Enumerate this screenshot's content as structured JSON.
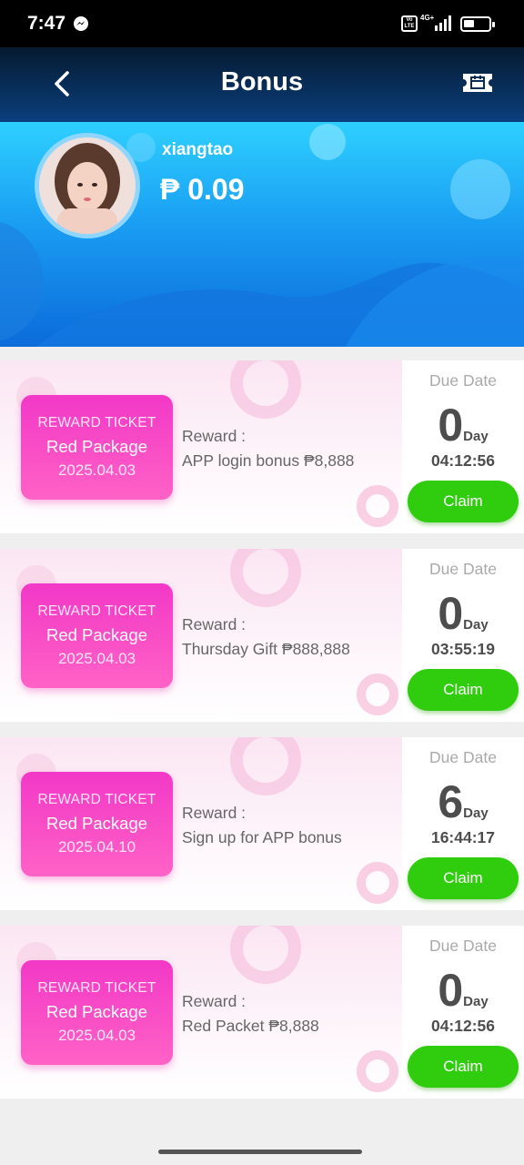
{
  "status_bar": {
    "time": "7:47",
    "volte": "Vo LTE",
    "network": "4G+"
  },
  "header": {
    "title": "Bonus",
    "back_icon": "chevron-left-icon",
    "right_icon": "ticket-icon"
  },
  "profile": {
    "username": "xiangtao",
    "balance": "₱ 0.09"
  },
  "rewards": [
    {
      "type": "REWARD TICKET",
      "name": "Red Package",
      "date": "2025.04.03",
      "label": "Reward :",
      "desc": "APP login bonus ₱8,888",
      "due_label": "Due Date",
      "days": "0",
      "day_unit": "Day",
      "time": "04:12:56",
      "claim": "Claim"
    },
    {
      "type": "REWARD TICKET",
      "name": "Red Package",
      "date": "2025.04.03",
      "label": "Reward :",
      "desc": "Thursday Gift ₱888,888",
      "due_label": "Due Date",
      "days": "0",
      "day_unit": "Day",
      "time": "03:55:19",
      "claim": "Claim"
    },
    {
      "type": "REWARD TICKET",
      "name": "Red Package",
      "date": "2025.04.10",
      "label": "Reward :",
      "desc": "Sign up for APP bonus",
      "due_label": "Due Date",
      "days": "6",
      "day_unit": "Day",
      "time": "16:44:17",
      "claim": "Claim"
    },
    {
      "type": "REWARD TICKET",
      "name": "Red Package",
      "date": "2025.04.03",
      "label": "Reward :",
      "desc": "Red Packet ₱8,888",
      "due_label": "Due Date",
      "days": "0",
      "day_unit": "Day",
      "time": "04:12:56",
      "claim": "Claim"
    }
  ],
  "colors": {
    "header_dark": "#061a30",
    "banner_blue": "#1a9ef3",
    "ticket_pink": "#f238c7",
    "claim_green": "#2fcd0d"
  }
}
